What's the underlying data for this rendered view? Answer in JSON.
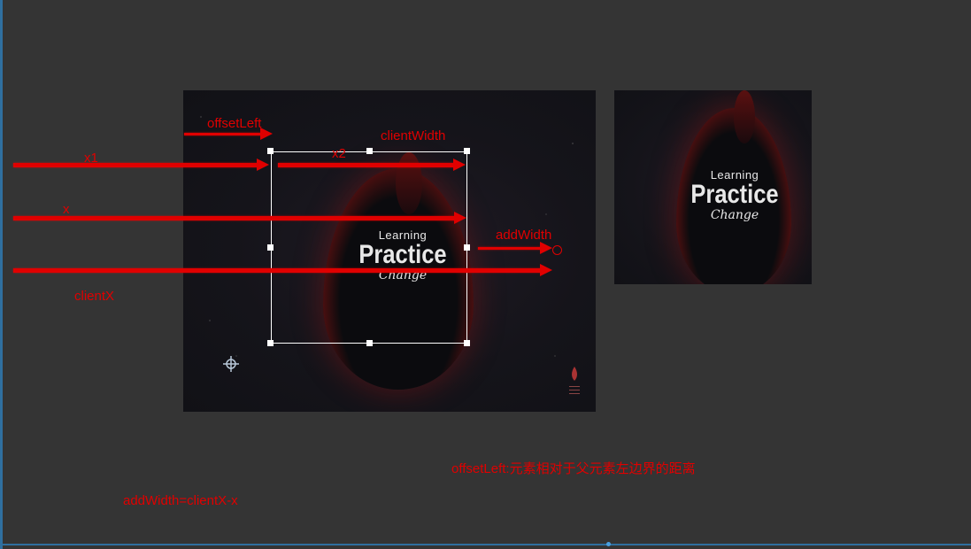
{
  "annotations": {
    "offset_left": "offsetLeft",
    "client_width": "clientWidth",
    "x1": "x1",
    "x2": "x2",
    "x": "x",
    "add_width": "addWidth",
    "client_x": "clientX",
    "offset_left_desc": "offsetLeft:元素相对于父元素左边界的距离",
    "formula": "addWidth=clientX-x"
  },
  "cover": {
    "small_title": "Learning",
    "big_title": "Practice",
    "script_title": "Change"
  },
  "colors": {
    "background": "#343434",
    "annotation": "#e00000",
    "selection": "#ffffff",
    "edge": "#2f6f9f"
  },
  "icons": [
    "crosshair-icon",
    "ring-icon",
    "resize-handle"
  ]
}
